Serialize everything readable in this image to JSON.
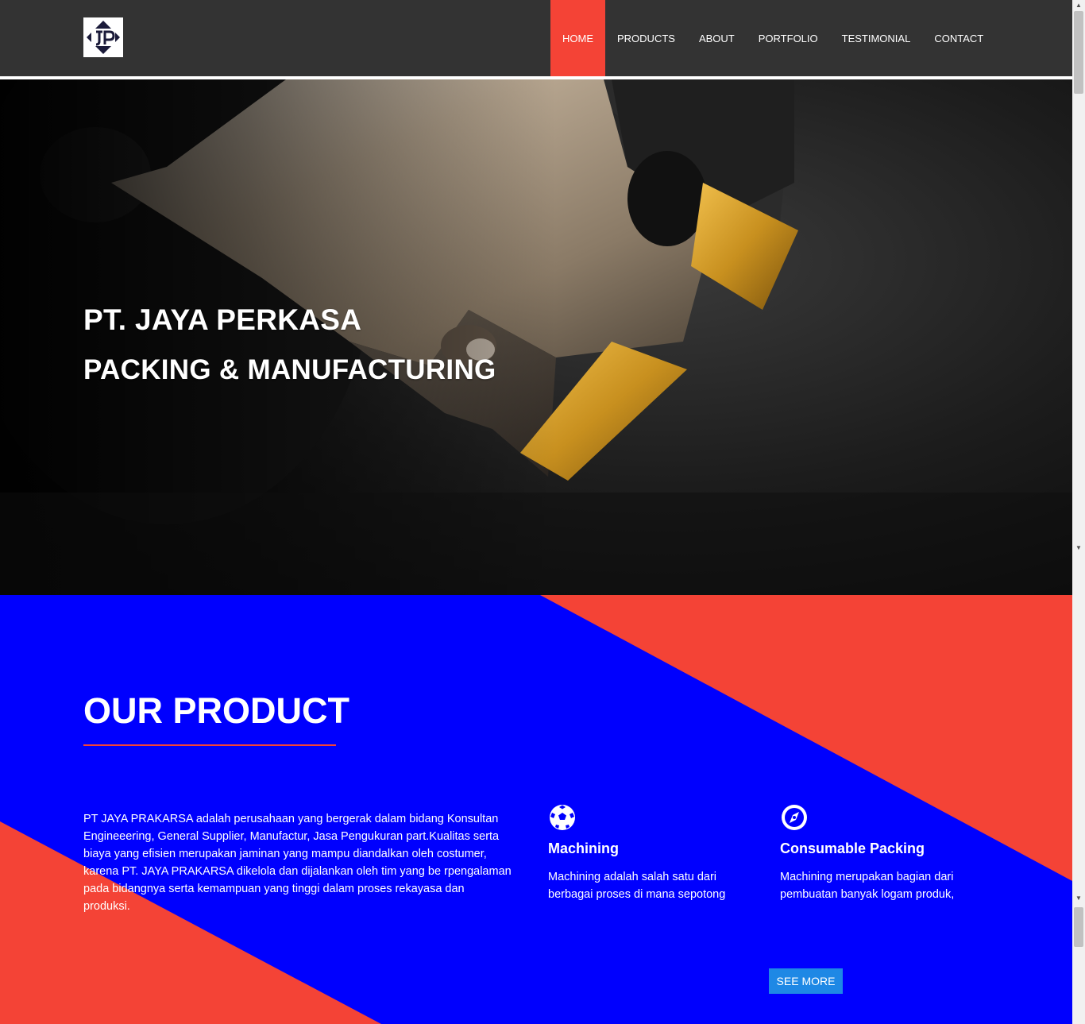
{
  "nav": {
    "logo_alt": "JP",
    "items": [
      {
        "label": "HOME",
        "active": true
      },
      {
        "label": "PRODUCTS"
      },
      {
        "label": "ABOUT"
      },
      {
        "label": "PORTFOLIO"
      },
      {
        "label": "TESTIMONIAL"
      },
      {
        "label": "CONTACT"
      }
    ]
  },
  "hero": {
    "title": "PT. JAYA PERKASA",
    "subtitle": "PACKING & MANUFACTURING"
  },
  "product": {
    "title": "OUR PRODUCT",
    "description": "PT JAYA PRAKARSA adalah perusahaan yang bergerak dalam bidang Konsultan Engineeering, General Supplier, Manufactur, Jasa Pengukuran part.Kualitas serta biaya yang efisien merupakan jaminan yang mampu diandalkan oleh costumer, karena PT. JAYA PRAKARSA dikelola dan dijalankan oleh tim yang be rpengalaman pada bidangnya serta kemampuan yang tinggi dalam proses rekayasa dan produksi.",
    "features": [
      {
        "icon": "soccer-ball-icon",
        "title": "Machining",
        "description": "Machining adalah salah satu dari berbagai proses di mana sepotong bahan baku dipotong"
      },
      {
        "icon": "compass-icon",
        "title": "Consumable Packing",
        "description": "Machining merupakan bagian dari pembuatan banyak logam produk, tetapi juga dapat digunakan"
      }
    ],
    "see_more_label": "SEE MORE"
  },
  "colors": {
    "navbar": "#333333",
    "accent_red": "#f44336",
    "product_blue": "#0000fe",
    "button_blue": "#1e88e5"
  },
  "scrollbar": {
    "up_arrow": "▲",
    "down_arrow": "▼"
  }
}
